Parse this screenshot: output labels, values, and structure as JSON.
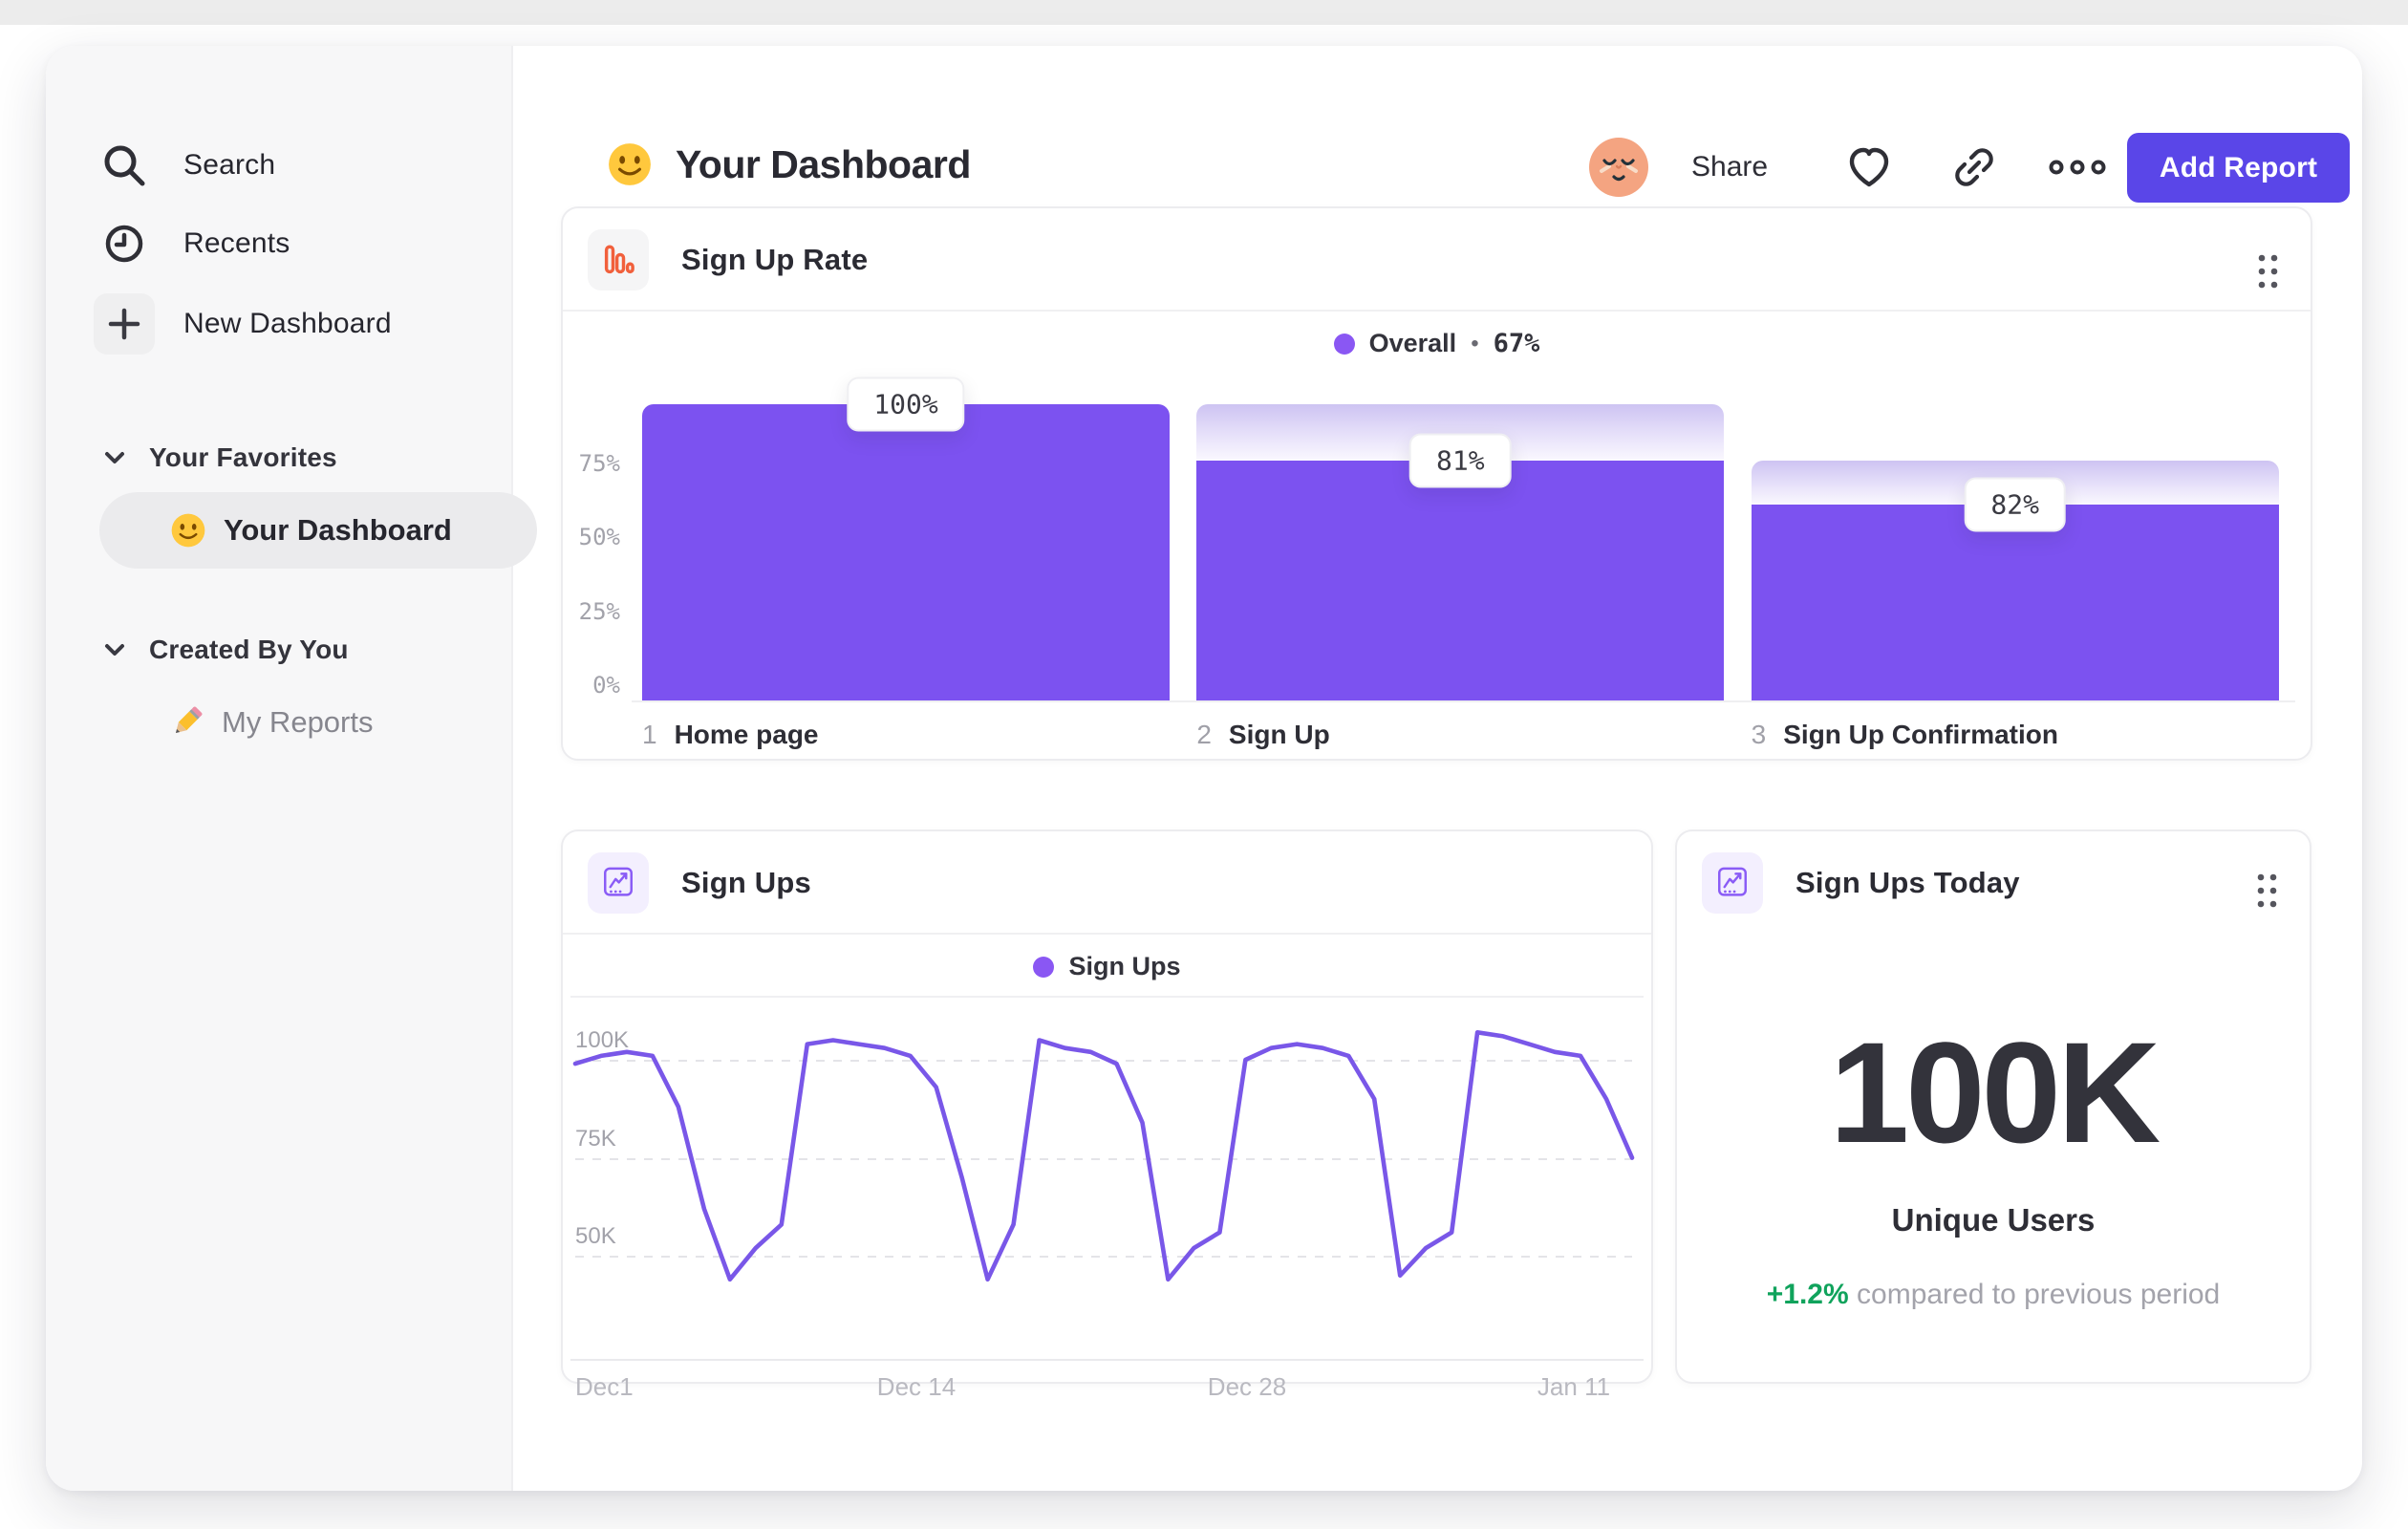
{
  "sidebar": {
    "nav": [
      {
        "label": "Search",
        "icon": "search-icon"
      },
      {
        "label": "Recents",
        "icon": "clock-icon"
      },
      {
        "label": "New Dashboard",
        "icon": "plus-icon"
      }
    ],
    "sections": [
      {
        "header": "Your Favorites",
        "items": [
          {
            "label": "Your Dashboard",
            "icon": "smiley-emoji",
            "active": true
          }
        ]
      },
      {
        "header": "Created By You",
        "items": [
          {
            "label": "My Reports",
            "icon": "pencil-emoji",
            "active": false
          }
        ]
      }
    ]
  },
  "header": {
    "title": "Your Dashboard",
    "title_icon": "smiley-emoji",
    "share_label": "Share",
    "add_report_label": "Add Report"
  },
  "colors": {
    "accent_purple": "#7C52F0",
    "button_indigo": "#5A46E8",
    "line_purple": "#7957E8",
    "legend_dot": "#8A57F3",
    "funnel_icon_orange": "#F1603C",
    "chart_icon_purple": "#8A5CF6",
    "positive_green": "#10A35C"
  },
  "legend_separator": "•",
  "chart_data": [
    {
      "type": "bar",
      "subtype": "funnel",
      "title": "Sign Up Rate",
      "legend_label": "Overall",
      "legend_value": "67%",
      "categories": [
        "Home page",
        "Sign Up",
        "Sign Up Confirmation"
      ],
      "step_numbers": [
        "1",
        "2",
        "3"
      ],
      "step_conversion_labels": [
        "100%",
        "81%",
        "82%"
      ],
      "overall_pct": [
        100,
        81,
        66
      ],
      "prev_pct": [
        100,
        100,
        81
      ],
      "yticks": [
        {
          "label": "75%",
          "value": 75
        },
        {
          "label": "50%",
          "value": 50
        },
        {
          "label": "25%",
          "value": 25
        },
        {
          "label": "0%",
          "value": 0
        }
      ],
      "ylim": [
        0,
        100
      ]
    },
    {
      "type": "line",
      "title": "Sign Ups",
      "legend_label": "Sign Ups",
      "x_tick_labels": [
        "Dec1",
        "Dec 14",
        "Dec 28",
        "Jan 11"
      ],
      "x_range": [
        "Dec 1",
        "Jan 11"
      ],
      "unit": "K",
      "yticks": [
        {
          "label": "100K",
          "value": 100
        },
        {
          "label": "75K",
          "value": 75
        },
        {
          "label": "50K",
          "value": 50
        }
      ],
      "values": [
        99,
        101,
        102,
        101,
        88,
        62,
        44,
        52,
        58,
        104,
        105,
        104,
        103,
        101,
        93,
        70,
        44,
        58,
        105,
        103,
        102,
        99,
        84,
        44,
        52,
        56,
        100,
        103,
        104,
        103,
        101,
        90,
        45,
        52,
        56,
        107,
        106,
        104,
        102,
        101,
        90,
        75
      ],
      "grid": "dashed"
    },
    {
      "type": "metric",
      "title": "Sign Ups Today",
      "value": "100K",
      "value_label": "Unique Users",
      "change": "+1.2%",
      "change_description": "compared to previous period"
    }
  ]
}
